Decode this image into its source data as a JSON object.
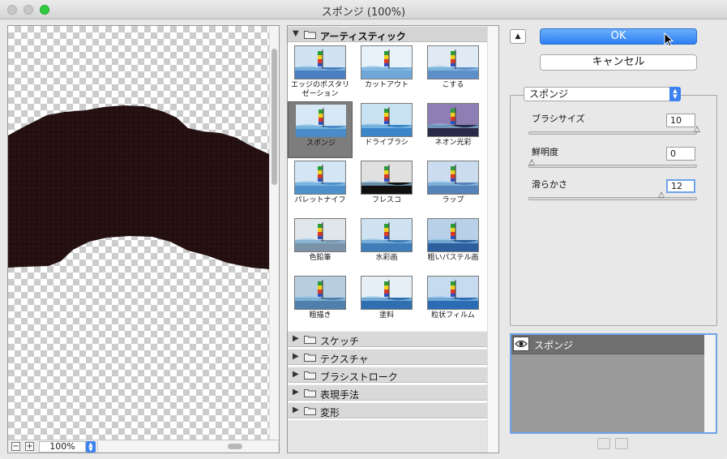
{
  "window": {
    "title": "スポンジ (100%)"
  },
  "preview": {
    "zoom_value": "100%",
    "zoom_minus": "−",
    "zoom_plus": "+"
  },
  "gallery": {
    "open_category": "アーティスティック",
    "filters": [
      {
        "label": "エッジのポスタリゼーション",
        "icon": "poster-edges-thumbnail"
      },
      {
        "label": "カットアウト",
        "icon": "cutout-thumbnail"
      },
      {
        "label": "こする",
        "icon": "smudge-stick-thumbnail"
      },
      {
        "label": "スポンジ",
        "icon": "sponge-thumbnail",
        "selected": true
      },
      {
        "label": "ドライブラシ",
        "icon": "dry-brush-thumbnail"
      },
      {
        "label": "ネオン光彩",
        "icon": "neon-glow-thumbnail"
      },
      {
        "label": "パレットナイフ",
        "icon": "palette-knife-thumbnail"
      },
      {
        "label": "フレスコ",
        "icon": "fresco-thumbnail"
      },
      {
        "label": "ラップ",
        "icon": "plastic-wrap-thumbnail"
      },
      {
        "label": "色鉛筆",
        "icon": "colored-pencil-thumbnail"
      },
      {
        "label": "水彩画",
        "icon": "watercolor-thumbnail"
      },
      {
        "label": "粗いパステル画",
        "icon": "rough-pastels-thumbnail"
      },
      {
        "label": "粗描き",
        "icon": "underpainting-thumbnail"
      },
      {
        "label": "塗料",
        "icon": "paint-daubs-thumbnail"
      },
      {
        "label": "粒状フィルム",
        "icon": "film-grain-thumbnail"
      }
    ],
    "categories": [
      {
        "label": "スケッチ"
      },
      {
        "label": "テクスチャ"
      },
      {
        "label": "ブラシストローク"
      },
      {
        "label": "表現手法"
      },
      {
        "label": "変形"
      }
    ]
  },
  "actions": {
    "ok_label": "OK",
    "cancel_label": "キャンセル",
    "collapse_icon": "chevron-up-icon"
  },
  "settings": {
    "filter_selected": "スポンジ",
    "params": [
      {
        "label": "ブラシサイズ",
        "value": "10",
        "fraction": 1.0
      },
      {
        "label": "鮮明度",
        "value": "0",
        "fraction": 0.0
      },
      {
        "label": "滑らかさ",
        "value": "12",
        "fraction": 0.7857
      }
    ]
  },
  "layers": {
    "items": [
      {
        "name": "スポンジ",
        "icon": "eye-icon"
      }
    ]
  },
  "colors": {
    "accent": "#2d7ff2",
    "selection_border": "#6ea3e8"
  }
}
